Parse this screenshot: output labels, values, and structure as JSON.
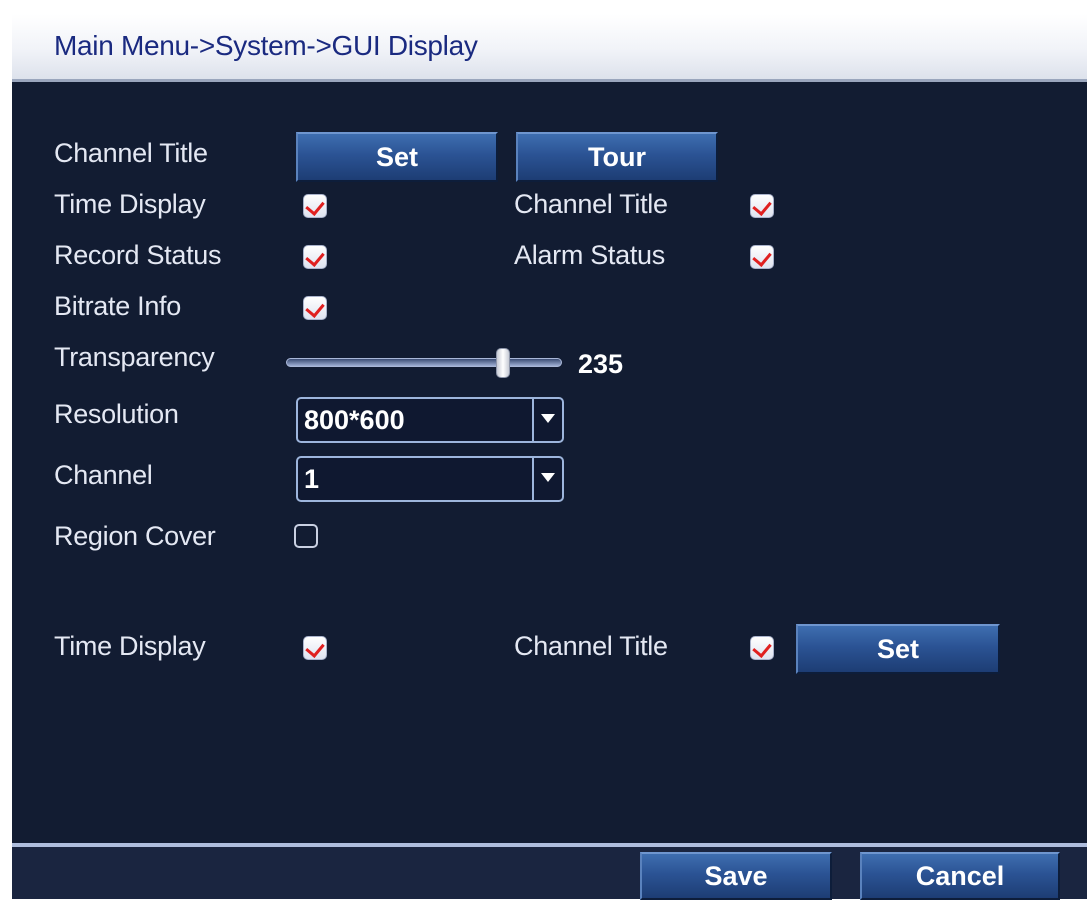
{
  "window": {
    "title": "Main Menu->System->GUI Display"
  },
  "row_channel_title": {
    "label": "Channel Title",
    "set_label": "Set",
    "tour_label": "Tour"
  },
  "checks": {
    "time_display": {
      "label": "Time Display",
      "checked": true
    },
    "channel_title": {
      "label": "Channel Title",
      "checked": true
    },
    "record_status": {
      "label": "Record Status",
      "checked": true
    },
    "alarm_status": {
      "label": "Alarm Status",
      "checked": true
    },
    "bitrate_info": {
      "label": "Bitrate Info",
      "checked": true
    },
    "region_cover": {
      "label": "Region Cover",
      "checked": false
    }
  },
  "transparency": {
    "label": "Transparency",
    "value": "235",
    "fraction": 0.8
  },
  "resolution": {
    "label": "Resolution",
    "value": "800*600"
  },
  "channel": {
    "label": "Channel",
    "value": "1"
  },
  "cover_section": {
    "time_display": {
      "label": "Time Display",
      "checked": true
    },
    "channel_title": {
      "label": "Channel Title",
      "checked": true
    },
    "set_label": "Set"
  },
  "footer": {
    "save_label": "Save",
    "cancel_label": "Cancel"
  },
  "colors": {
    "background": "#121c32",
    "title_text": "#1a2a80",
    "check_mark": "#e02020",
    "button": "#2b5394"
  }
}
